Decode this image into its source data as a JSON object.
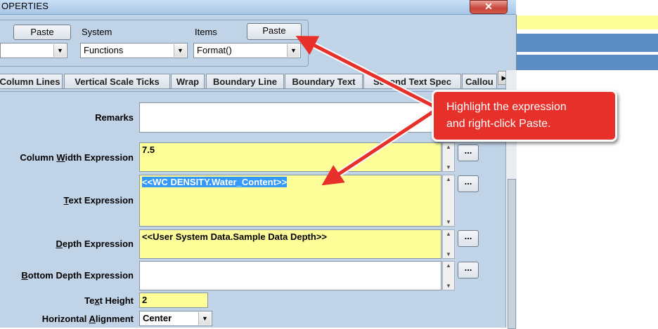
{
  "window": {
    "title": "OPERTIES",
    "close_label": "✕"
  },
  "toolbar": {
    "paste_left_label": "Paste",
    "system_label": "System",
    "items_label": "Items",
    "paste_right_label": "Paste",
    "combo_left_value": "",
    "system_value": "Functions",
    "items_value": "Format()"
  },
  "tabs": [
    "Column Lines",
    "Vertical Scale Ticks",
    "Wrap",
    "Boundary Line",
    "Boundary Text",
    "Second Text Spec",
    "Callou"
  ],
  "form": {
    "remarks_label": "Remarks",
    "remarks_value": "",
    "col_width_label": "Column Width Expression",
    "col_width_value": "7.5",
    "text_expr_label": "Text Expression",
    "text_expr_value": "<<WC DENSITY.Water_Content>>",
    "depth_label": "Depth Expression",
    "depth_value": "<<User System Data.Sample Data Depth>>",
    "bottom_depth_label": "Bottom Depth Expression",
    "bottom_depth_value": "",
    "text_height_label": "Text Height",
    "text_height_value": "2",
    "h_align_label": "Horizontal Alignment",
    "h_align_value": "Center",
    "ellipsis_label": "..."
  },
  "callout": {
    "line1": "Highlight the expression",
    "line2": "and right-click Paste."
  },
  "colors": {
    "field_yellow": "#ffff99",
    "callout_red": "#e8302a",
    "panel_blue": "#c1d3e7"
  }
}
